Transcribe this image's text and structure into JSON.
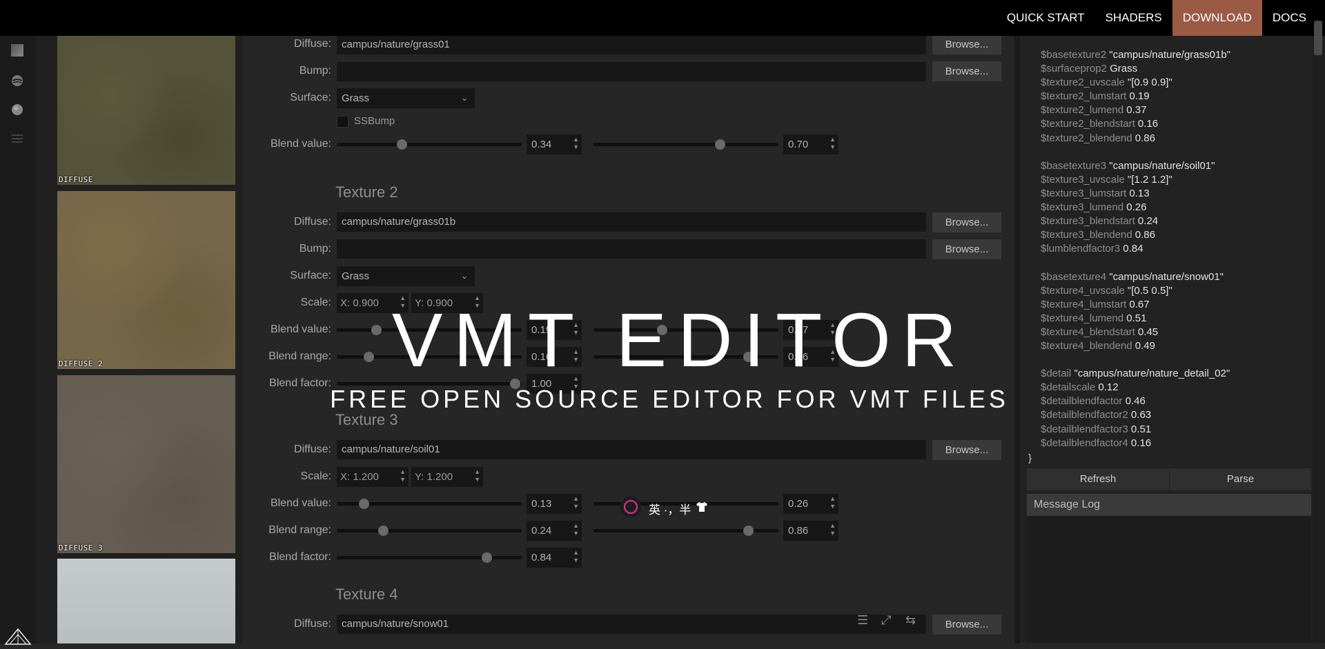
{
  "nav": {
    "items": [
      {
        "label": "QUICK START"
      },
      {
        "label": "SHADERS"
      },
      {
        "label": "DOWNLOAD"
      },
      {
        "label": "DOCS"
      }
    ]
  },
  "thumbnails": [
    {
      "label": "DIFFUSE"
    },
    {
      "label": "DIFFUSE 2"
    },
    {
      "label": "DIFFUSE 3"
    },
    {
      "label": ""
    }
  ],
  "labels": {
    "diffuse": "Diffuse:",
    "bump": "Bump:",
    "surface": "Surface:",
    "scale": "Scale:",
    "blend_value": "Blend value:",
    "blend_range": "Blend range:",
    "blend_factor": "Blend factor:",
    "browse": "Browse...",
    "ssbump": "SSBump"
  },
  "texture1": {
    "diffuse": "campus/nature/grass01",
    "bump": "",
    "surface": "Grass",
    "blend_value": {
      "a": "0.34",
      "b": "0.70"
    }
  },
  "texture2": {
    "heading": "Texture 2",
    "diffuse": "campus/nature/grass01b",
    "bump": "",
    "surface": "Grass",
    "scale_x": "X: 0.900",
    "scale_y": "Y: 0.900",
    "blend_value": {
      "a": "0.19",
      "b": "0.37"
    },
    "blend_range": {
      "a": "0.16",
      "b": "0.86"
    },
    "blend_factor": "1.00"
  },
  "texture3": {
    "heading": "Texture 3",
    "diffuse": "campus/nature/soil01",
    "scale_x": "X: 1.200",
    "scale_y": "Y: 1.200",
    "blend_value": {
      "a": "0.13",
      "b": "0.26"
    },
    "blend_range": {
      "a": "0.24",
      "b": "0.86"
    },
    "blend_factor": "0.84"
  },
  "texture4": {
    "heading": "Texture 4",
    "diffuse": "campus/nature/snow01"
  },
  "code_lines": [
    {
      "k": "$basetexture2",
      "v": "\"campus/nature/grass01b\""
    },
    {
      "k": "$surfaceprop2",
      "v": "Grass"
    },
    {
      "k": "$texture2_uvscale",
      "v": "\"[0.9 0.9]\""
    },
    {
      "k": "$texture2_lumstart",
      "v": "0.19"
    },
    {
      "k": "$texture2_lumend",
      "v": "0.37"
    },
    {
      "k": "$texture2_blendstart",
      "v": "0.16"
    },
    {
      "k": "$texture2_blendend",
      "v": "0.86"
    },
    {
      "k": "",
      "v": ""
    },
    {
      "k": "$basetexture3",
      "v": "\"campus/nature/soil01\""
    },
    {
      "k": "$texture3_uvscale",
      "v": "\"[1.2 1.2]\""
    },
    {
      "k": "$texture3_lumstart",
      "v": "0.13"
    },
    {
      "k": "$texture3_lumend",
      "v": "0.26"
    },
    {
      "k": "$texture3_blendstart",
      "v": "0.24"
    },
    {
      "k": "$texture3_blendend",
      "v": "0.86"
    },
    {
      "k": "$lumblendfactor3",
      "v": "0.84"
    },
    {
      "k": "",
      "v": ""
    },
    {
      "k": "$basetexture4",
      "v": "\"campus/nature/snow01\""
    },
    {
      "k": "$texture4_uvscale",
      "v": "\"[0.5 0.5]\""
    },
    {
      "k": "$texture4_lumstart",
      "v": "0.67"
    },
    {
      "k": "$texture4_lumend",
      "v": "0.51"
    },
    {
      "k": "$texture4_blendstart",
      "v": "0.45"
    },
    {
      "k": "$texture4_blendend",
      "v": "0.49"
    },
    {
      "k": "",
      "v": ""
    },
    {
      "k": "$detail",
      "v": "\"campus/nature/nature_detail_02\""
    },
    {
      "k": "$detailscale",
      "v": "0.12"
    },
    {
      "k": "$detailblendfactor",
      "v": "0.46"
    },
    {
      "k": "$detailblendfactor2",
      "v": "0.63"
    },
    {
      "k": "$detailblendfactor3",
      "v": "0.51"
    },
    {
      "k": "$detailblendfactor4",
      "v": "0.16"
    }
  ],
  "code_close": "}",
  "buttons": {
    "refresh": "Refresh",
    "parse": "Parse"
  },
  "message_log": {
    "title": "Message Log"
  },
  "hero": {
    "title": "VMT EDITOR",
    "subtitle": "FREE OPEN SOURCE EDITOR FOR VMT FILES"
  },
  "ime": {
    "text": "英 ·，半"
  },
  "colors": {
    "accent": "#9a5a44",
    "ime_ring": "#c2327c"
  }
}
